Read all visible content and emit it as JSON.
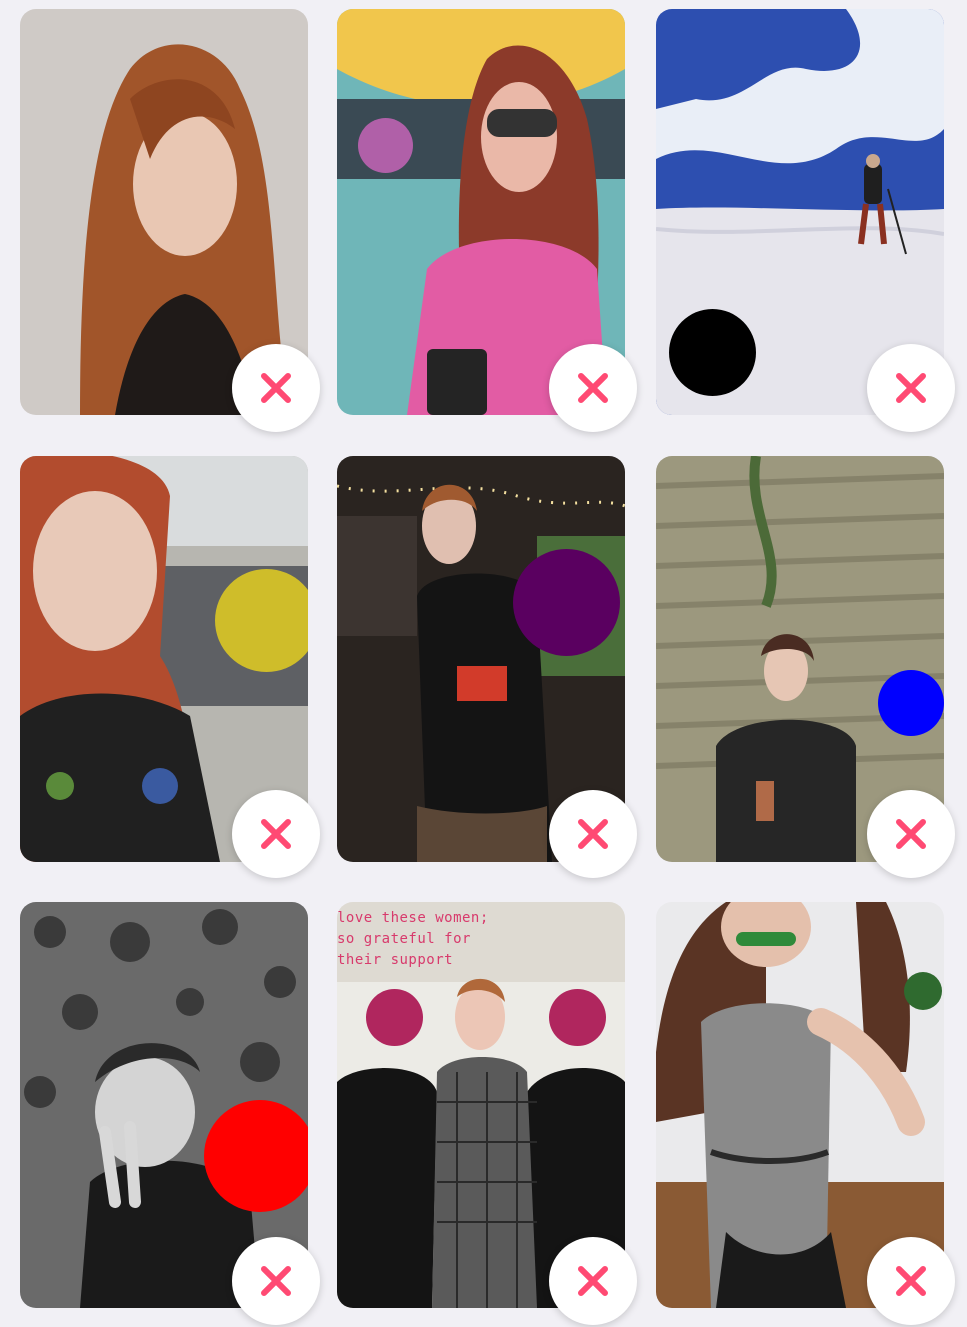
{
  "grid": {
    "photos": [
      {
        "name": "photo-1",
        "bg": "#c9c4bf",
        "accent": "#9c4a22",
        "dot": null
      },
      {
        "name": "photo-2",
        "bg": "#7fbfc2",
        "accent": "#d85aa0",
        "dot": {
          "color": "#b060a8"
        }
      },
      {
        "name": "photo-3",
        "bg": "#e8ebf2",
        "accent": "#2746a8",
        "dot": {
          "color": "#000000"
        }
      },
      {
        "name": "photo-4",
        "bg": "#8a8c88",
        "accent": "#3a3a38",
        "dot": {
          "color": "#cfbd2a"
        }
      },
      {
        "name": "photo-5",
        "bg": "#2a2622",
        "accent": "#141414",
        "dot": {
          "color": "#5a0060"
        }
      },
      {
        "name": "photo-6",
        "bg": "#6f6a5a",
        "accent": "#2a2a2a",
        "dot": {
          "color": "#0000ff"
        }
      },
      {
        "name": "photo-7",
        "bg": "#777777",
        "accent": "#1c1c1c",
        "dot": {
          "color": "#ff0000"
        }
      },
      {
        "name": "photo-8",
        "bg": "#d8d4cc",
        "accent": "#1e1e1e",
        "dot": {
          "color": "#b0265e"
        },
        "caption": "love these women;\nso grateful for\ntheir support"
      },
      {
        "name": "photo-9",
        "bg": "#7a6a5e",
        "accent": "#8a8a8a",
        "dot": {
          "color": "#2f6a2f"
        }
      }
    ],
    "remove_icon": "close-icon",
    "remove_color": "#ff4a73"
  }
}
